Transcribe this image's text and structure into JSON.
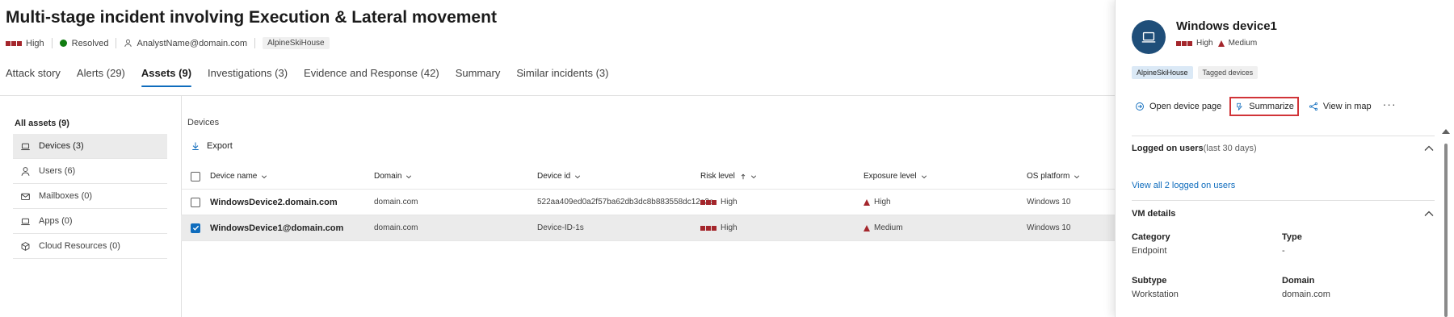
{
  "incident": {
    "title": "Multi-stage incident involving Execution & Lateral movement",
    "severity": "High",
    "status": "Resolved",
    "assignee": "AnalystName@domain.com",
    "tag": "AlpineSkiHouse"
  },
  "tabs": [
    {
      "label": "Attack story"
    },
    {
      "label": "Alerts (29)"
    },
    {
      "label": "Assets (9)",
      "active": true
    },
    {
      "label": "Investigations (3)"
    },
    {
      "label": "Evidence and Response (42)"
    },
    {
      "label": "Summary"
    },
    {
      "label": "Similar incidents (3)"
    }
  ],
  "sidebar": {
    "header": "All assets (9)",
    "items": [
      {
        "label": "Devices (3)",
        "icon": "laptop-icon",
        "active": true
      },
      {
        "label": "Users (6)",
        "icon": "person-icon"
      },
      {
        "label": "Mailboxes (0)",
        "icon": "mail-icon"
      },
      {
        "label": "Apps (0)",
        "icon": "apps-icon"
      },
      {
        "label": "Cloud Resources (0)",
        "icon": "cube-icon"
      }
    ]
  },
  "devices": {
    "section_title": "Devices",
    "export_label": "Export",
    "columns": [
      "Device name",
      "Domain",
      "Device id",
      "Risk level",
      "Exposure level",
      "OS platform"
    ],
    "rows": [
      {
        "name": "WindowsDevice2.domain.com",
        "domain": "domain.com",
        "device_id": "522aa409ed0a2f57ba62db3dc8b883558dc12a3a",
        "risk": "High",
        "exposure": "High",
        "os": "Windows 10",
        "selected": false
      },
      {
        "name": "WindowsDevice1@domain.com",
        "domain": "domain.com",
        "device_id": "Device-ID-1s",
        "risk": "High",
        "exposure": "Medium",
        "os": "Windows 10",
        "selected": true
      }
    ]
  },
  "panel": {
    "title": "Windows device1",
    "risk": "High",
    "exposure": "Medium",
    "tags": [
      "AlpineSkiHouse",
      "Tagged devices"
    ],
    "actions": {
      "open": "Open device page",
      "summarize": "Summarize",
      "map": "View in map",
      "more": "···"
    },
    "logged_on": {
      "title": "Logged on users",
      "subtitle": "(last 30 days)",
      "link": "View all 2 logged on users"
    },
    "vm": {
      "title": "VM details",
      "category_label": "Category",
      "category_value": "Endpoint",
      "type_label": "Type",
      "type_value": "-",
      "subtype_label": "Subtype",
      "subtype_value": "Workstation",
      "domain_label": "Domain",
      "domain_value": "domain.com"
    }
  },
  "colors": {
    "accent": "#0f6cbd",
    "severity": "#a4262c",
    "resolved": "#107c10",
    "highlight": "#d13438"
  }
}
